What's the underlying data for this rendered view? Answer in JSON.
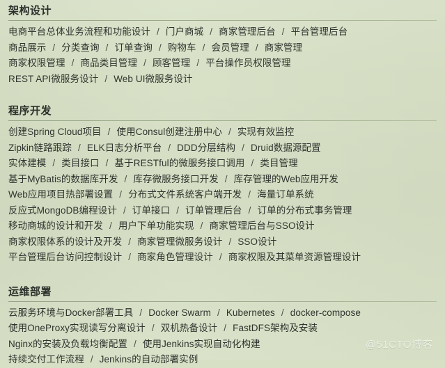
{
  "page": {
    "background_color": "#d7e0c5",
    "text_color": "#30342f",
    "rule_color": "#8c9a7a",
    "watermark": "@51CTO博客"
  },
  "sections": [
    {
      "id": "architecture-design",
      "title": "架构设计",
      "lines": [
        [
          "电商平台总体业务流程和功能设计",
          "门户商城",
          "商家管理后台",
          "平台管理后台"
        ],
        [
          "商品展示",
          "分类查询",
          "订单查询",
          "购物车",
          "会员管理",
          "商家管理"
        ],
        [
          "商家权限管理",
          "商品类目管理",
          "顾客管理",
          "平台操作员权限管理"
        ],
        [
          "REST API微服务设计",
          "Web UI微服务设计"
        ]
      ]
    },
    {
      "id": "program-development",
      "title": "程序开发",
      "lines": [
        [
          "创建Spring Cloud项目",
          "使用Consul创建注册中心",
          "实现有效监控"
        ],
        [
          "Zipkin链路跟踪",
          "ELK日志分析平台",
          "DDD分层结构",
          "Druid数据源配置"
        ],
        [
          "实体建模",
          "类目接口",
          "基于RESTful的微服务接口调用",
          "类目管理"
        ],
        [
          "基于MyBatis的数据库开发",
          "库存微服务接口开发",
          "库存管理的Web应用开发"
        ],
        [
          "Web应用项目热部署设置",
          "分布式文件系统客户端开发",
          "海量订单系统"
        ],
        [
          "反应式MongoDB编程设计",
          "订单接口",
          "订单管理后台",
          "订单的分布式事务管理"
        ],
        [
          "移动商城的设计和开发",
          "用户下单功能实现",
          "商家管理后台与SSO设计"
        ],
        [
          "商家权限体系的设计及开发",
          "商家管理微服务设计",
          "SSO设计"
        ],
        [
          "平台管理后台访问控制设计",
          "商家角色管理设计",
          "商家权限及其菜单资源管理设计"
        ]
      ]
    },
    {
      "id": "ops-deployment",
      "title": "运维部署",
      "lines": [
        [
          "云服务环境与Docker部署工具",
          "Docker Swarm",
          "Kubernetes",
          "docker-compose"
        ],
        [
          "使用OneProxy实现读写分离设计",
          "双机热备设计",
          "FastDFS架构及安装"
        ],
        [
          "Nginx的安装及负载均衡配置",
          "使用Jenkins实现自动化构建"
        ],
        [
          "持续交付工作流程",
          "Jenkins的自动部署实例"
        ]
      ]
    }
  ],
  "separator": "/"
}
